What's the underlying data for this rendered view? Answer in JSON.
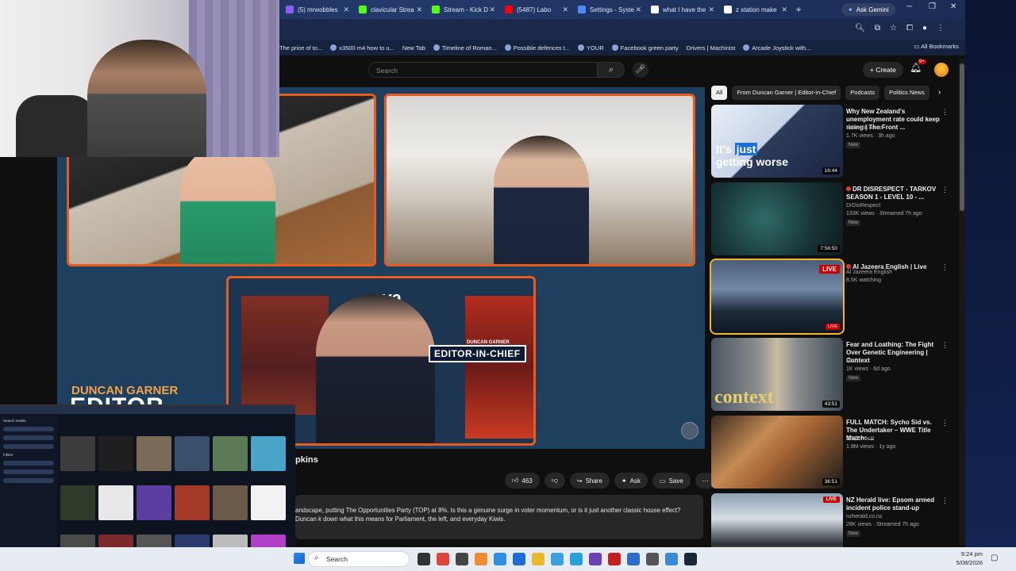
{
  "browser": {
    "tabs": [
      {
        "label": "(5) mrwobbles",
        "color": "#8b5cf6"
      },
      {
        "label": "clavicular Strea",
        "color": "#53fc18"
      },
      {
        "label": "Stream - Kick D",
        "color": "#53fc18"
      },
      {
        "label": "(5487) Labo",
        "color": "#ff0000"
      },
      {
        "label": "Settings - Syste",
        "color": "#4c8bf5"
      },
      {
        "label": "what I have the",
        "color": "#ffffff"
      },
      {
        "label": "z station make",
        "color": "#ffffff"
      }
    ],
    "new_tab": "+",
    "gemini_label": "Ask Gemini",
    "bookmarks": [
      "The price of to...",
      "x3500 m4 how to u...",
      "New Tab",
      "Timeline of Roman...",
      "Possible defences t...",
      "YOUR",
      "Facebook green party",
      "Drivers | Machinist",
      "Arcade Joystick with..."
    ],
    "all_bookmarks": "All Bookmarks"
  },
  "youtube": {
    "search_placeholder": "Search",
    "create_label": "Create",
    "notif_count": "9+",
    "video": {
      "banner_logo": "ova",
      "eic_badge": "EDITOR-IN-CHIEF",
      "eic_small": "DUNCAN GARNER",
      "bg_name": "DUNCAN GARNER",
      "bg_editor": "EDITOR"
    },
    "title_fragment": "pkins",
    "actions": {
      "likes": "463",
      "share": "Share",
      "ask": "Ask",
      "save": "Save"
    },
    "description": "andscape, putting The Opportunities Party (TOP) at 8%. Is this a genuine surge in voter momentum, or is it just another classic house effect? Duncan k down what this means for Parliament, the left, and everyday Kiwis.",
    "chips": [
      "All",
      "From Duncan Garner | Editor-in-Chief",
      "Podcasts",
      "Politics News"
    ],
    "recommendations": [
      {
        "title": "Why New Zealand's unemployment rate could keep rising | The Front ...",
        "channel": "nzherald.co.nz",
        "meta": "1.7K views · 3h ago",
        "badge": "New",
        "duration": "16:44",
        "thumb_text_a": "It's",
        "thumb_text_hl": "just",
        "thumb_text_b": "getting worse"
      },
      {
        "title": "DR DISRESPECT - TARKOV SEASON 1 - LEVEL 10 - ...",
        "channel": "DrDisRespect",
        "meta": "133K views · Streamed 7h ago",
        "badge": "New",
        "duration": "7:56:50"
      },
      {
        "title": "Al Jazeera English | Live",
        "channel": "Al Jazeera English",
        "meta": "8.5K watching",
        "live": "LIVE",
        "live_small": "LIVE"
      },
      {
        "title": "Fear and Loathing: The Fight Over Genetic Engineering | Context",
        "channel": "RNZ",
        "meta": "1K views · 6d ago",
        "badge": "New",
        "duration": "43:51",
        "thumb_text": "context"
      },
      {
        "title": "FULL MATCH: Sycho Sid vs. The Undertaker – WWE Title Match: ...",
        "channel": "WWE Vault",
        "meta": "1.8M views · 1y ago",
        "duration": "36:51"
      },
      {
        "title": "NZ Herald live: Epsom armed incident police stand-up",
        "channel": "nzherald.co.nz",
        "meta": "28K views · Streamed 7h ago",
        "badge": "New",
        "live_small": "LIVE"
      }
    ]
  },
  "mini_screen": {
    "heading": "Search results",
    "filters_label": "Filters"
  },
  "taskbar": {
    "search_label": "Search",
    "time": "9:24 pm",
    "date": "5/08/2026"
  }
}
